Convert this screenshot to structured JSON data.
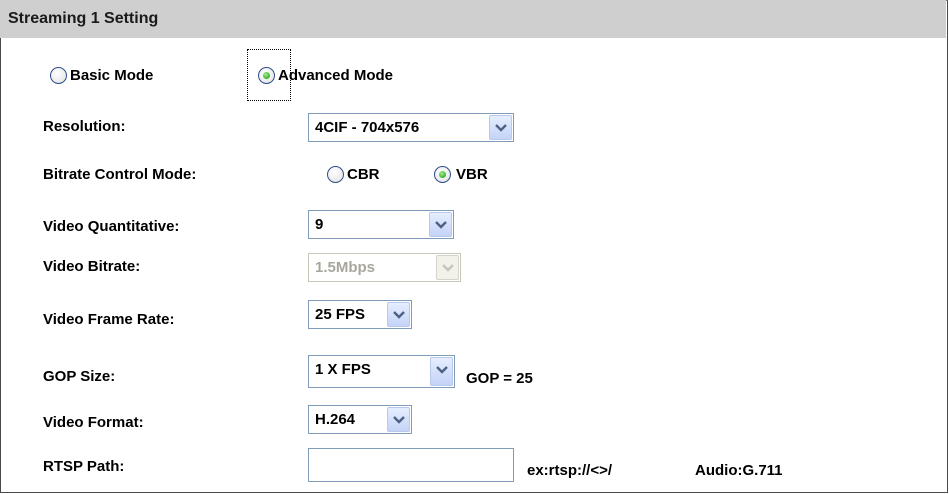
{
  "header": {
    "title": "Streaming 1 Setting"
  },
  "mode": {
    "basic_label": "Basic Mode",
    "advanced_label": "Advanced Mode",
    "selected": "Advanced Mode"
  },
  "resolution": {
    "label": "Resolution:",
    "value": "4CIF - 704x576"
  },
  "bitrate_control": {
    "label": "Bitrate Control Mode:",
    "cbr_label": "CBR",
    "vbr_label": "VBR",
    "selected": "VBR"
  },
  "video_quantitative": {
    "label": "Video Quantitative:",
    "value": "9"
  },
  "video_bitrate": {
    "label": "Video Bitrate:",
    "value": "1.5Mbps",
    "disabled": true
  },
  "video_frame_rate": {
    "label": "Video Frame Rate:",
    "value": "25 FPS"
  },
  "gop_size": {
    "label": "GOP Size:",
    "value": "1 X FPS",
    "note": "GOP = 25"
  },
  "video_format": {
    "label": "Video Format:",
    "value": "H.264"
  },
  "rtsp_path": {
    "label": "RTSP Path:",
    "value": "",
    "example": "ex:rtsp://<>/",
    "audio": "Audio:G.711"
  },
  "icons": {
    "dropdown": "chevron-down-icon"
  },
  "colors": {
    "header_bg": "#cfcfcf",
    "radio_selected": "#2fa51f",
    "input_border": "#7f9db9"
  }
}
